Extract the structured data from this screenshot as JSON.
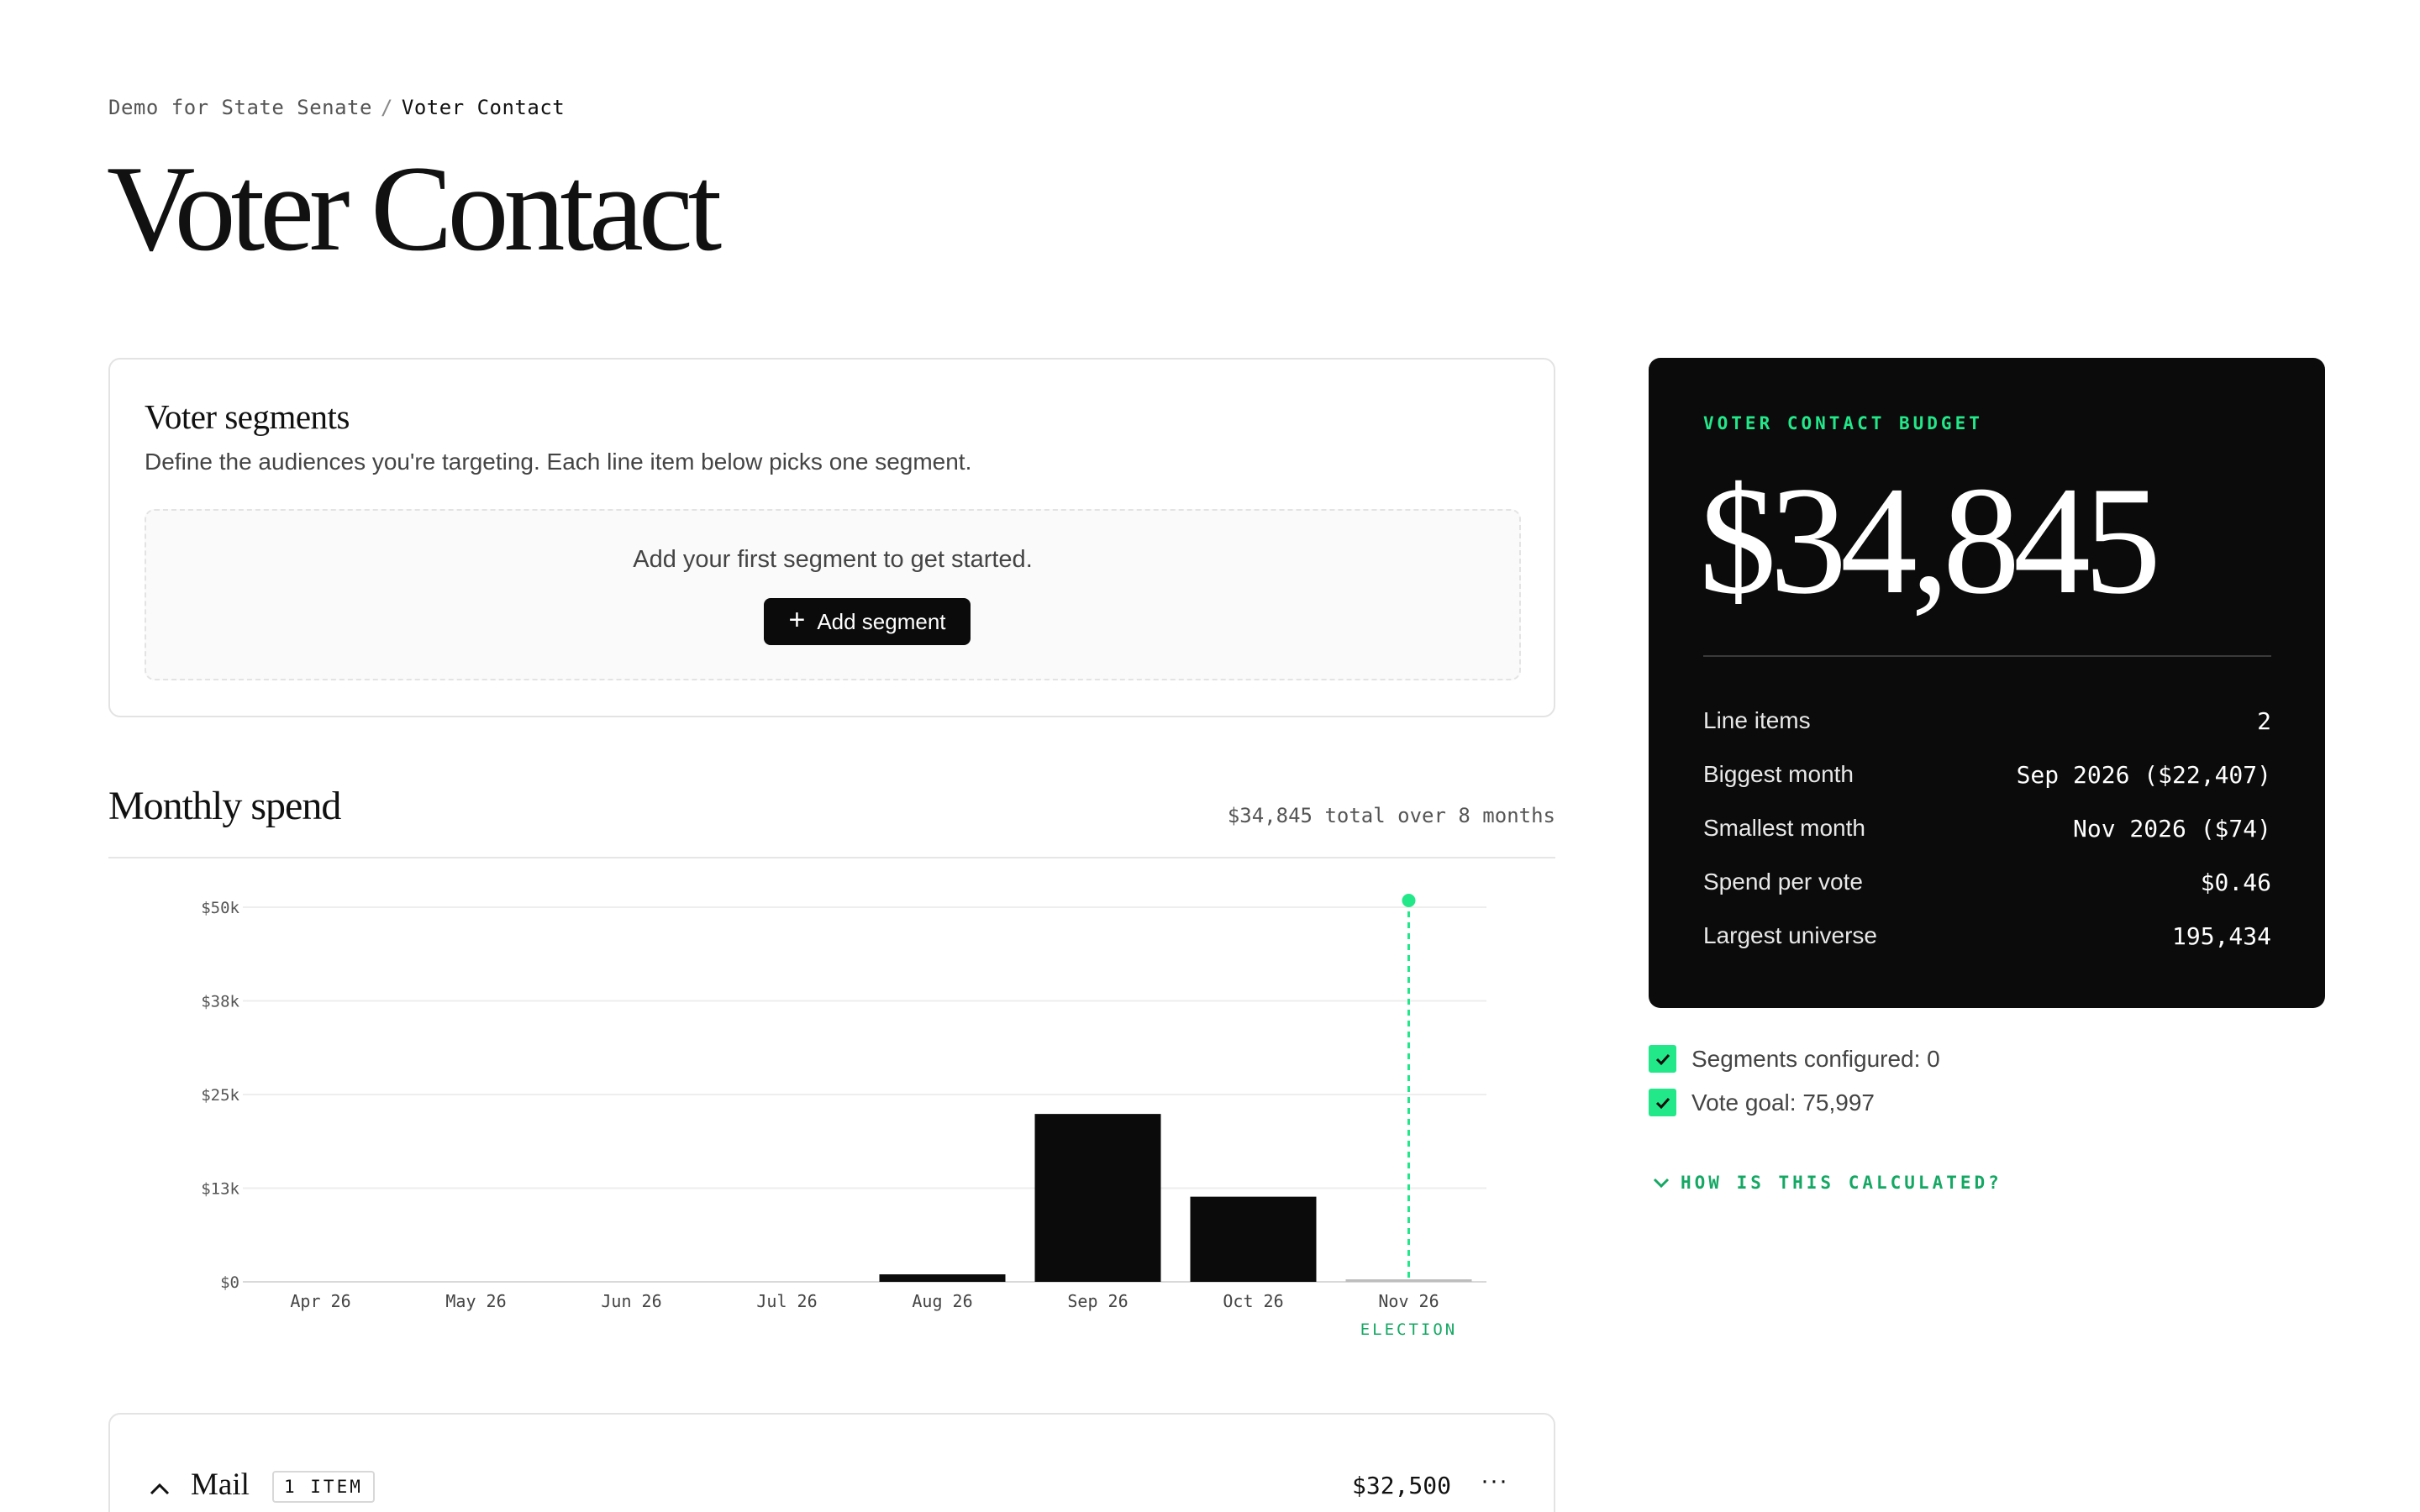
{
  "breadcrumb": {
    "parent": "Demo for State Senate",
    "separator": "/",
    "current": "Voter Contact"
  },
  "page_title": "Voter Contact",
  "segments": {
    "title": "Voter segments",
    "description": "Define the audiences you're targeting. Each line item below picks one segment.",
    "empty_text": "Add your first segment to get started.",
    "add_button_label": "Add segment"
  },
  "monthly_spend": {
    "title": "Monthly spend",
    "summary": "$34,845 total over 8 months"
  },
  "chart_data": {
    "type": "bar",
    "categories": [
      "Apr 26",
      "May 26",
      "Jun 26",
      "Jul 26",
      "Aug 26",
      "Sep 26",
      "Oct 26",
      "Nov 26"
    ],
    "values": [
      0,
      0,
      0,
      0,
      1000,
      22407,
      11364,
      74
    ],
    "y_ticks": [
      "$0",
      "$13k",
      "$25k",
      "$38k",
      "$50k"
    ],
    "y_tick_values": [
      0,
      12500,
      25000,
      37500,
      50000
    ],
    "ylim": [
      0,
      50000
    ],
    "marker": {
      "category": "Nov 26",
      "label": "ELECTION"
    },
    "bar_color": "#0b0b0b",
    "marker_color": "#22e88a",
    "grid": true
  },
  "mail": {
    "label": "Mail",
    "badge": "1 ITEM",
    "amount": "$32,500",
    "more": "···"
  },
  "budget": {
    "eyebrow": "VOTER CONTACT BUDGET",
    "total": "$34,845",
    "stats": [
      {
        "label": "Line items",
        "value": "2"
      },
      {
        "label": "Biggest month",
        "value": "Sep 2026 ($22,407)"
      },
      {
        "label": "Smallest month",
        "value": "Nov 2026 ($74)"
      },
      {
        "label": "Spend per vote",
        "value": "$0.46"
      },
      {
        "label": "Largest universe",
        "value": "195,434"
      }
    ]
  },
  "checklist": [
    {
      "label": "Segments configured: 0",
      "checked": true
    },
    {
      "label": "Vote goal: 75,997",
      "checked": true
    }
  ],
  "calc_link": "HOW IS THIS CALCULATED?",
  "colors": {
    "accent": "#22e88a",
    "accent_text": "#15a864",
    "dark": "#0b0b0b"
  },
  "icons": {
    "plus": "plus-icon",
    "check": "check-icon",
    "chevron_up": "chevron-up-icon",
    "chevron_down": "chevron-down-icon",
    "more": "more-icon"
  }
}
